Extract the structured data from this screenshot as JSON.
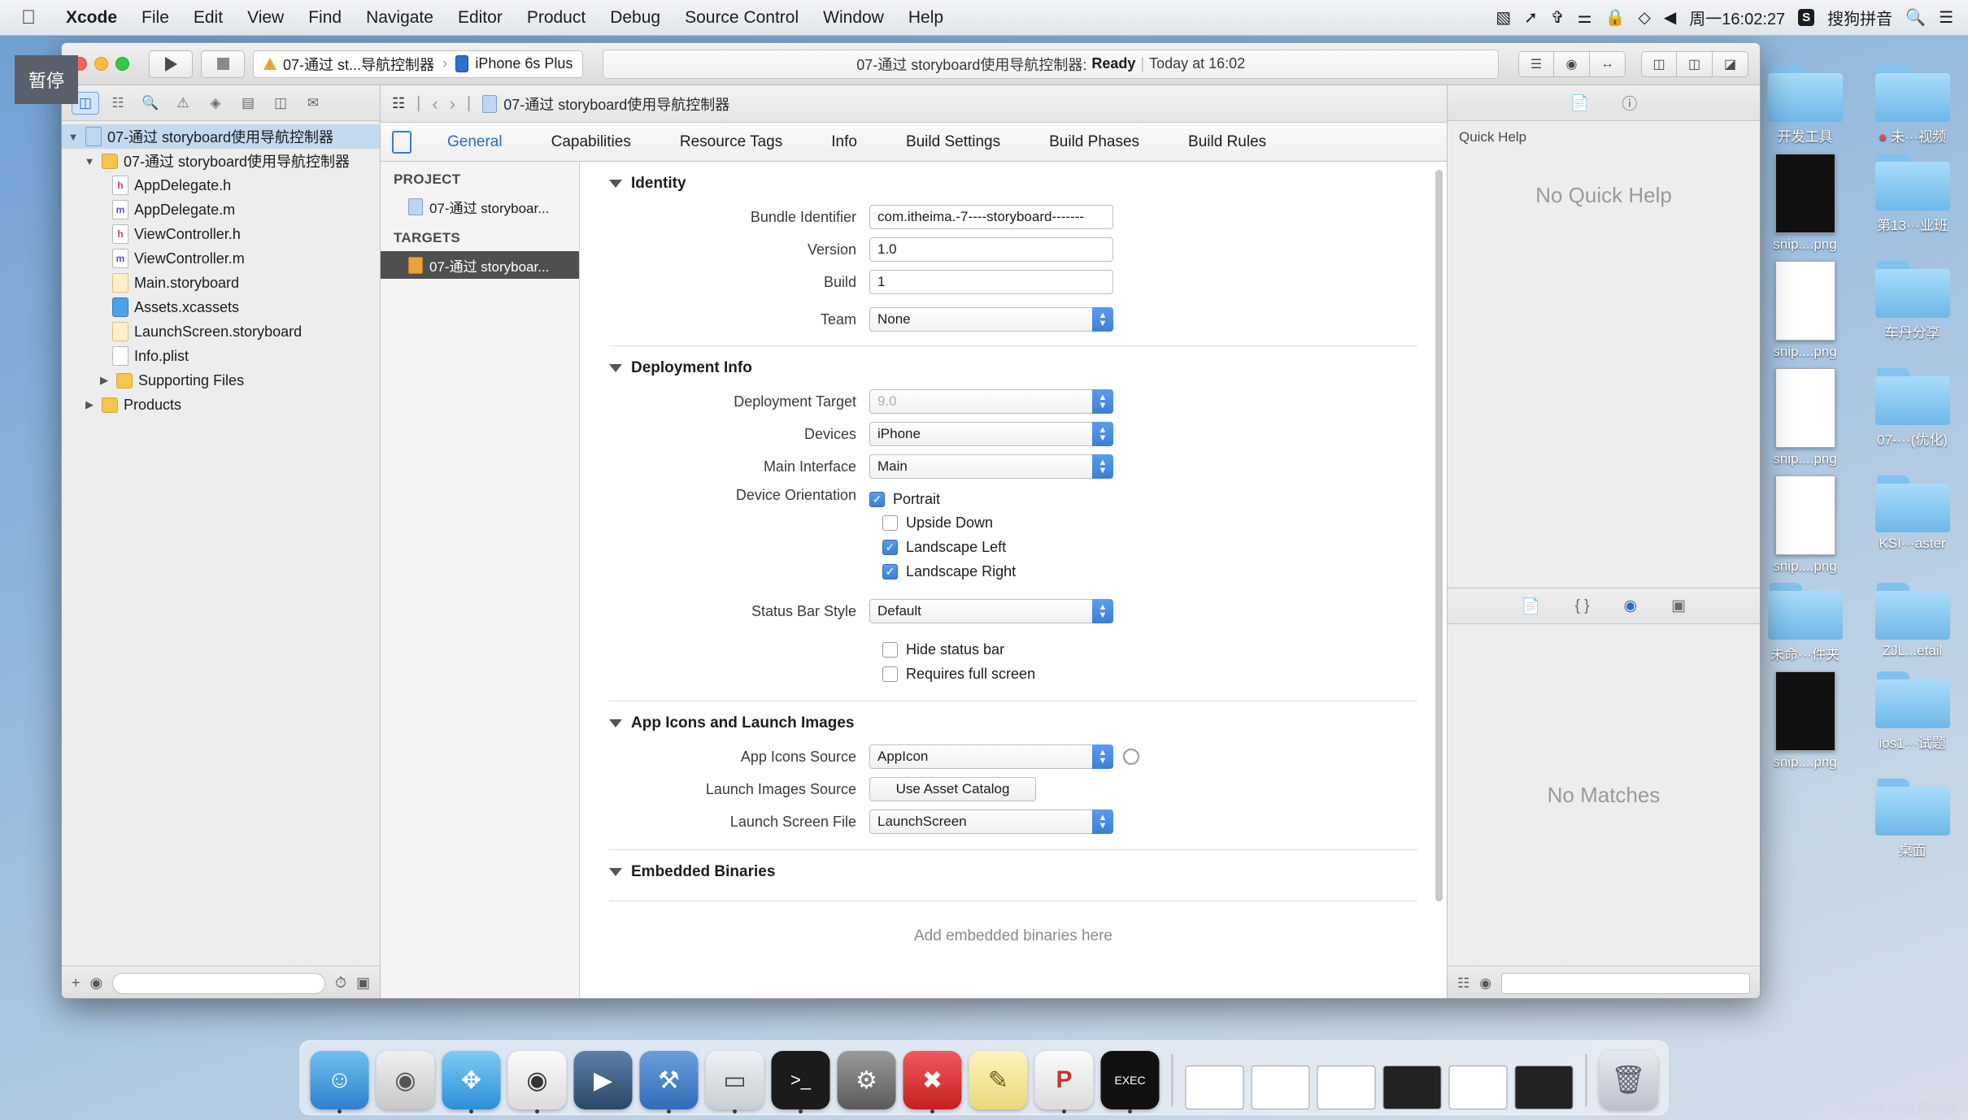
{
  "menubar": {
    "apple": "apple-logo",
    "items": [
      "Xcode",
      "File",
      "Edit",
      "View",
      "Find",
      "Navigate",
      "Editor",
      "Product",
      "Debug",
      "Source Control",
      "Window",
      "Help"
    ],
    "status_icons": [
      "screen-record-icon",
      "airplay-icon",
      "bluetooth-icon",
      "wifi-icon",
      "lock-icon",
      "shield-icon",
      "volume-icon"
    ],
    "clock": "周一16:02:27",
    "input_method_badge": "S",
    "input_method": "搜狗拼音",
    "search_icon": "search-icon",
    "list_icon": "control-center-icon"
  },
  "tooltip": {
    "text": "暂停"
  },
  "toolbar": {
    "run_icon": "play-icon",
    "stop_icon": "stop-icon",
    "scheme": "07-通过 st...导航控制器",
    "destination": "iPhone 6s Plus",
    "status_project": "07-通过 storyboard使用导航控制器:",
    "status_state": "Ready",
    "status_divider": "|",
    "status_time": "Today at 16:02",
    "right_icons": [
      "standard-editor-icon",
      "assistant-editor-icon",
      "version-editor-icon",
      "navigator-toggle-icon",
      "debug-toggle-icon",
      "utilities-toggle-icon"
    ]
  },
  "navigator": {
    "tabs": [
      "project-navigator-icon",
      "source-control-icon",
      "search-icon",
      "issue-icon",
      "test-icon",
      "debug-icon",
      "breakpoint-icon",
      "report-icon"
    ],
    "active_tab_index": 0,
    "tree": [
      {
        "label": "07-通过 storyboard使用导航控制器",
        "icon": "project-icon",
        "indent": 0,
        "twisty": "open",
        "selected": true
      },
      {
        "label": "07-通过 storyboard使用导航控制器",
        "icon": "folder-icon",
        "indent": 1,
        "twisty": "open",
        "selected": false
      },
      {
        "label": "AppDelegate.h",
        "icon": "header-file-icon",
        "indent": 2,
        "twisty": "",
        "selected": false
      },
      {
        "label": "AppDelegate.m",
        "icon": "impl-file-icon",
        "indent": 2,
        "twisty": "",
        "selected": false
      },
      {
        "label": "ViewController.h",
        "icon": "header-file-icon",
        "indent": 2,
        "twisty": "",
        "selected": false
      },
      {
        "label": "ViewController.m",
        "icon": "impl-file-icon",
        "indent": 2,
        "twisty": "",
        "selected": false
      },
      {
        "label": "Main.storyboard",
        "icon": "storyboard-icon",
        "indent": 2,
        "twisty": "",
        "selected": false
      },
      {
        "label": "Assets.xcassets",
        "icon": "assets-icon",
        "indent": 2,
        "twisty": "",
        "selected": false
      },
      {
        "label": "LaunchScreen.storyboard",
        "icon": "storyboard-icon",
        "indent": 2,
        "twisty": "",
        "selected": false
      },
      {
        "label": "Info.plist",
        "icon": "plist-icon",
        "indent": 2,
        "twisty": "",
        "selected": false
      },
      {
        "label": "Supporting Files",
        "icon": "folder-icon",
        "indent": 2,
        "twisty": "closed",
        "selected": false
      },
      {
        "label": "Products",
        "icon": "folder-icon",
        "indent": 1,
        "twisty": "closed",
        "selected": false
      }
    ],
    "footer": {
      "add": "+",
      "filter_icon": "filter-icon",
      "placeholder": "",
      "right_icons": [
        "recent-icon",
        "unsaved-icon"
      ]
    }
  },
  "jumpbar": {
    "grid_icon": "related-items-icon",
    "back_icon": "back-chevron-icon",
    "forward_icon": "forward-chevron-icon",
    "crumb": "07-通过 storyboard使用导航控制器"
  },
  "editor": {
    "tabs": [
      "General",
      "Capabilities",
      "Resource Tags",
      "Info",
      "Build Settings",
      "Build Phases",
      "Build Rules"
    ],
    "active_tab": "General"
  },
  "targets_pane": {
    "project_header": "PROJECT",
    "project_item": "07-通过 storyboar...",
    "targets_header": "TARGETS",
    "target_item": "07-通过 storyboar..."
  },
  "identity": {
    "title": "Identity",
    "bundle_identifier_label": "Bundle Identifier",
    "bundle_identifier_value": "com.itheima.-7----storyboard-------",
    "version_label": "Version",
    "version_value": "1.0",
    "build_label": "Build",
    "build_value": "1",
    "team_label": "Team",
    "team_value": "None"
  },
  "deployment": {
    "title": "Deployment Info",
    "target_label": "Deployment Target",
    "target_value": "9.0",
    "devices_label": "Devices",
    "devices_value": "iPhone",
    "main_interface_label": "Main Interface",
    "main_interface_value": "Main",
    "orientation_label": "Device Orientation",
    "orientations": [
      {
        "label": "Portrait",
        "checked": true
      },
      {
        "label": "Upside Down",
        "checked": false
      },
      {
        "label": "Landscape Left",
        "checked": true
      },
      {
        "label": "Landscape Right",
        "checked": true
      }
    ],
    "status_bar_style_label": "Status Bar Style",
    "status_bar_style_value": "Default",
    "extra_checks": [
      {
        "label": "Hide status bar",
        "checked": false
      },
      {
        "label": "Requires full screen",
        "checked": false
      }
    ]
  },
  "app_icons": {
    "title": "App Icons and Launch Images",
    "app_icons_source_label": "App Icons Source",
    "app_icons_source_value": "AppIcon",
    "launch_images_source_label": "Launch Images Source",
    "launch_images_source_value": "Use Asset Catalog",
    "launch_screen_file_label": "Launch Screen File",
    "launch_screen_file_value": "LaunchScreen"
  },
  "embedded": {
    "title": "Embedded Binaries",
    "empty_text": "Add embedded binaries here"
  },
  "utilities": {
    "tabs": [
      "file-inspector-icon",
      "quick-help-icon"
    ],
    "quick_help_title": "Quick Help",
    "quick_help_body": "No Quick Help",
    "library_tabs": [
      "file-template-library-icon",
      "code-snippet-library-icon",
      "object-library-icon",
      "media-library-icon"
    ],
    "library_active_index": 2,
    "library_body": "No Matches",
    "footer_icons": [
      "grid-view-icon",
      "filter-icon"
    ],
    "footer_placeholder": ""
  },
  "desktop_icons": [
    {
      "type": "folder",
      "label": "开发工具"
    },
    {
      "type": "folder",
      "label": "未···视频",
      "dot": true
    },
    {
      "type": "thumb-black",
      "label": "snip....png"
    },
    {
      "type": "folder",
      "label": "第13···业班"
    },
    {
      "type": "thumb",
      "label": "snip....png"
    },
    {
      "type": "folder",
      "label": "车丹分享"
    },
    {
      "type": "thumb",
      "label": "snip....png"
    },
    {
      "type": "folder",
      "label": "07-···(优化)"
    },
    {
      "type": "thumb",
      "label": "snip....png"
    },
    {
      "type": "folder",
      "label": "KSI···aster"
    },
    {
      "type": "folder",
      "label": "未命···件夹"
    },
    {
      "type": "folder",
      "label": "ZJL...etail"
    },
    {
      "type": "thumb-black",
      "label": "snip....png"
    },
    {
      "type": "folder",
      "label": "ios1···试题"
    },
    {
      "type": "folder",
      "label": "桌面"
    }
  ],
  "dock": [
    {
      "name": "finder-icon",
      "glyph": "☺",
      "color": "#2f8fe0",
      "running": true
    },
    {
      "name": "launchpad-icon",
      "glyph": "🚀",
      "color": "#dcdcdc",
      "running": false
    },
    {
      "name": "safari-icon",
      "glyph": "🧭",
      "color": "#3aa3e8",
      "running": true
    },
    {
      "name": "opera-icon",
      "glyph": "O",
      "color": "#f2f2f2",
      "running": true
    },
    {
      "name": "video-player-icon",
      "glyph": "🎬",
      "color": "#3a5f8a",
      "running": false
    },
    {
      "name": "xcode-icon",
      "glyph": "🔨",
      "color": "#4a7fc4",
      "running": true
    },
    {
      "name": "simulator-icon",
      "glyph": "📱",
      "color": "#d8dde4",
      "running": true
    },
    {
      "name": "terminal-icon",
      "glyph": ">_",
      "color": "#1b1b1b",
      "running": true
    },
    {
      "name": "system-preferences-icon",
      "glyph": "⚙",
      "color": "#8a8a8a",
      "running": false
    },
    {
      "name": "xmind-icon",
      "glyph": "✖",
      "color": "#e03a3a",
      "running": true
    },
    {
      "name": "notes-icon",
      "glyph": "📝",
      "color": "#f7e9a0",
      "running": false
    },
    {
      "name": "pycharm-icon",
      "glyph": "P",
      "color": "#e8e8e8",
      "running": true
    },
    {
      "name": "exec-icon",
      "glyph": "EXEC",
      "color": "#111111",
      "running": true
    }
  ],
  "dock_windows": [
    {
      "name": "minimized-window-1"
    },
    {
      "name": "minimized-window-2"
    },
    {
      "name": "minimized-window-3"
    },
    {
      "name": "minimized-window-4"
    },
    {
      "name": "minimized-window-5"
    },
    {
      "name": "minimized-window-6"
    }
  ],
  "trash": {
    "name": "trash-icon"
  },
  "watermark": "CSDN @清风清晨"
}
